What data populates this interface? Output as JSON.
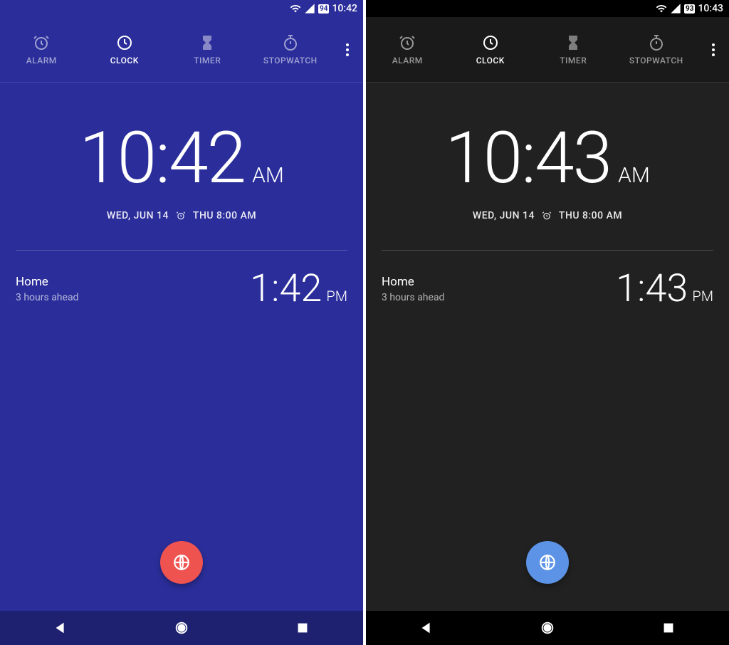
{
  "screens": [
    {
      "theme": "light",
      "statusbar": {
        "battery": "94",
        "time": "10:42"
      },
      "tabs": [
        {
          "name": "alarm",
          "label": "ALARM",
          "active": false
        },
        {
          "name": "clock",
          "label": "CLOCK",
          "active": true
        },
        {
          "name": "timer",
          "label": "TIMER",
          "active": false
        },
        {
          "name": "stopwatch",
          "label": "STOPWATCH",
          "active": false
        }
      ],
      "main_time": "10:42",
      "main_ampm": "AM",
      "date": "WED, JUN 14",
      "next_alarm": "THU 8:00 AM",
      "secondary": {
        "name": "Home",
        "offset": "3 hours ahead",
        "time": "1:42",
        "ampm": "PM"
      },
      "fab_color": "#ef5350"
    },
    {
      "theme": "dark",
      "statusbar": {
        "battery": "93",
        "time": "10:43"
      },
      "tabs": [
        {
          "name": "alarm",
          "label": "ALARM",
          "active": false
        },
        {
          "name": "clock",
          "label": "CLOCK",
          "active": true
        },
        {
          "name": "timer",
          "label": "TIMER",
          "active": false
        },
        {
          "name": "stopwatch",
          "label": "STOPWATCH",
          "active": false
        }
      ],
      "main_time": "10:43",
      "main_ampm": "AM",
      "date": "WED, JUN 14",
      "next_alarm": "THU 8:00 AM",
      "secondary": {
        "name": "Home",
        "offset": "3 hours ahead",
        "time": "1:43",
        "ampm": "PM"
      },
      "fab_color": "#5c93e6"
    }
  ]
}
